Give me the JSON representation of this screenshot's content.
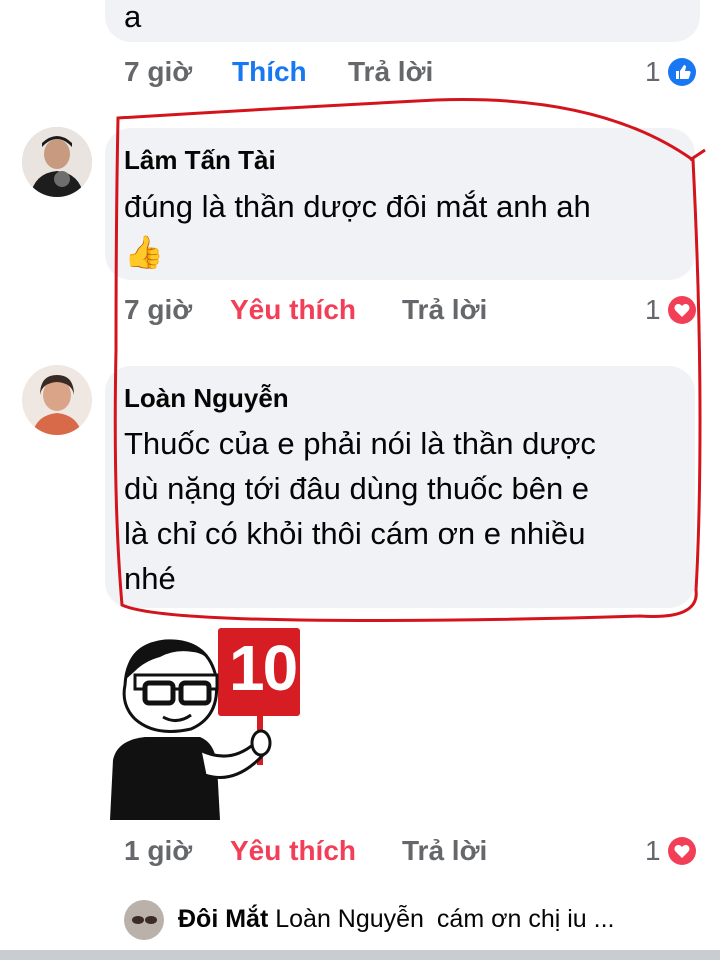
{
  "top_comment": {
    "text_tail": "a"
  },
  "top_meta": {
    "time": "7 giờ",
    "like": "Thích",
    "reply": "Trả lời",
    "count": "1",
    "reaction": "like-icon",
    "color": "#1877f2"
  },
  "comment1": {
    "author": "Lâm Tấn Tài",
    "text": "đúng là thần dược đôi mắt anh ah",
    "emoji": "👍",
    "time": "7 giờ",
    "like": "Yêu thích",
    "reply": "Trả lời",
    "count": "1"
  },
  "comment2": {
    "author": "Loàn Nguyễn",
    "lines": [
      "Thuốc của e phải nói là thần dược",
      "dù nặng tới đâu dùng thuốc bên e",
      "là chỉ có khỏi thôi cám ơn e nhiều",
      "nhé"
    ],
    "time": "1 giờ",
    "like": "Yêu thích",
    "reply": "Trả lời",
    "count": "1"
  },
  "comment2_meta_mid": {
    "time": "7 giờ",
    "like": "Yêu thích",
    "reply": "Trả lời",
    "count": "1"
  },
  "sticker": {
    "sign": "10"
  },
  "reply_preview": {
    "author": "Đôi Mắt",
    "mention": "Loàn Nguyễn",
    "text": "cám ơn chị iu ..."
  },
  "colors": {
    "love": "#f33e58",
    "like": "#1877f2",
    "highlight": "#d4141c",
    "bubble": "#f0f2f5"
  }
}
